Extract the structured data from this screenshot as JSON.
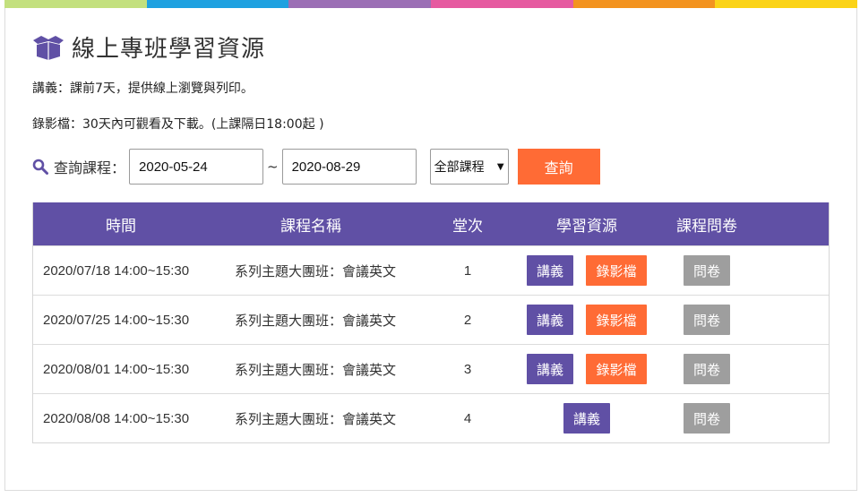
{
  "colors": {
    "accent_purple": "#6050a5",
    "accent_orange": "#ff6b35",
    "survey_gray": "#9e9e9e",
    "top_bar": [
      "#c3e07e",
      "#1fa1e0",
      "#9b6fb5",
      "#e65aa0",
      "#f3931f",
      "#fbd317"
    ]
  },
  "page": {
    "title": "線上專班學習資源",
    "title_icon": "open-box-icon",
    "info_handout": "講義：課前7天，提供線上瀏覽與列印。",
    "info_video": "錄影檔：30天內可觀看及下載。(上課隔日18:00起 )"
  },
  "search": {
    "icon": "search-icon",
    "label": "查詢課程：",
    "date_from": "2020-05-24",
    "separator": "~",
    "date_to": "2020-08-29",
    "course_select": "全部課程",
    "button": "查詢"
  },
  "table": {
    "headers": {
      "time": "時間",
      "name": "課程名稱",
      "session": "堂次",
      "resources": "學習資源",
      "survey": "課程問卷"
    },
    "rows": [
      {
        "time": "2020/07/18 14:00~15:30",
        "name": "系列主題大團班：會議英文",
        "session": "1",
        "handout": "講義",
        "video": "錄影檔",
        "survey": "問卷"
      },
      {
        "time": "2020/07/25 14:00~15:30",
        "name": "系列主題大團班：會議英文",
        "session": "2",
        "handout": "講義",
        "video": "錄影檔",
        "survey": "問卷"
      },
      {
        "time": "2020/08/01 14:00~15:30",
        "name": "系列主題大團班：會議英文",
        "session": "3",
        "handout": "講義",
        "video": "錄影檔",
        "survey": "問卷"
      },
      {
        "time": "2020/08/08 14:00~15:30",
        "name": "系列主題大團班：會議英文",
        "session": "4",
        "handout": "講義",
        "survey": "問卷"
      }
    ]
  }
}
